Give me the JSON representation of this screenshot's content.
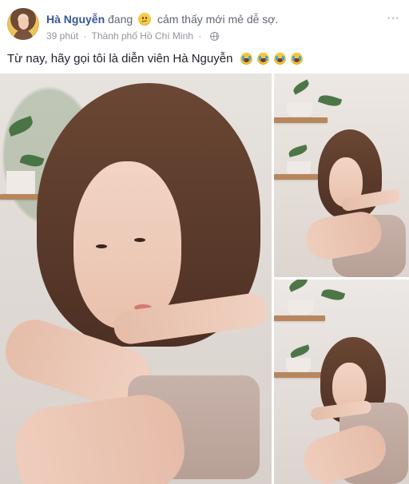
{
  "post": {
    "author_name": "Hà Nguyễn",
    "feeling_prefix": "đang",
    "feeling_emoji": "confused-face-icon",
    "feeling_text": "cảm thấy mới mẻ dễ sợ.",
    "time": "39 phút",
    "location": "Thành phố Hồ Chí Minh",
    "privacy_icon": "globe-icon",
    "more_label": "···",
    "caption_text": "Từ nay, hãy gọi tôi là diễn viên Hà Nguyễn",
    "caption_emojis": [
      "crying-face-icon",
      "crying-face-icon",
      "crying-face-icon",
      "crying-face-icon"
    ]
  },
  "gallery": {
    "photos": [
      {
        "label": "main-photo",
        "kind": "portrait close-up"
      },
      {
        "label": "secondary-photo-top",
        "kind": "seated pose"
      },
      {
        "label": "secondary-photo-bottom",
        "kind": "seated pose"
      }
    ]
  },
  "colors": {
    "author": "#385898",
    "muted": "#90949c",
    "text": "#1d2129",
    "background": "#ffffff"
  }
}
